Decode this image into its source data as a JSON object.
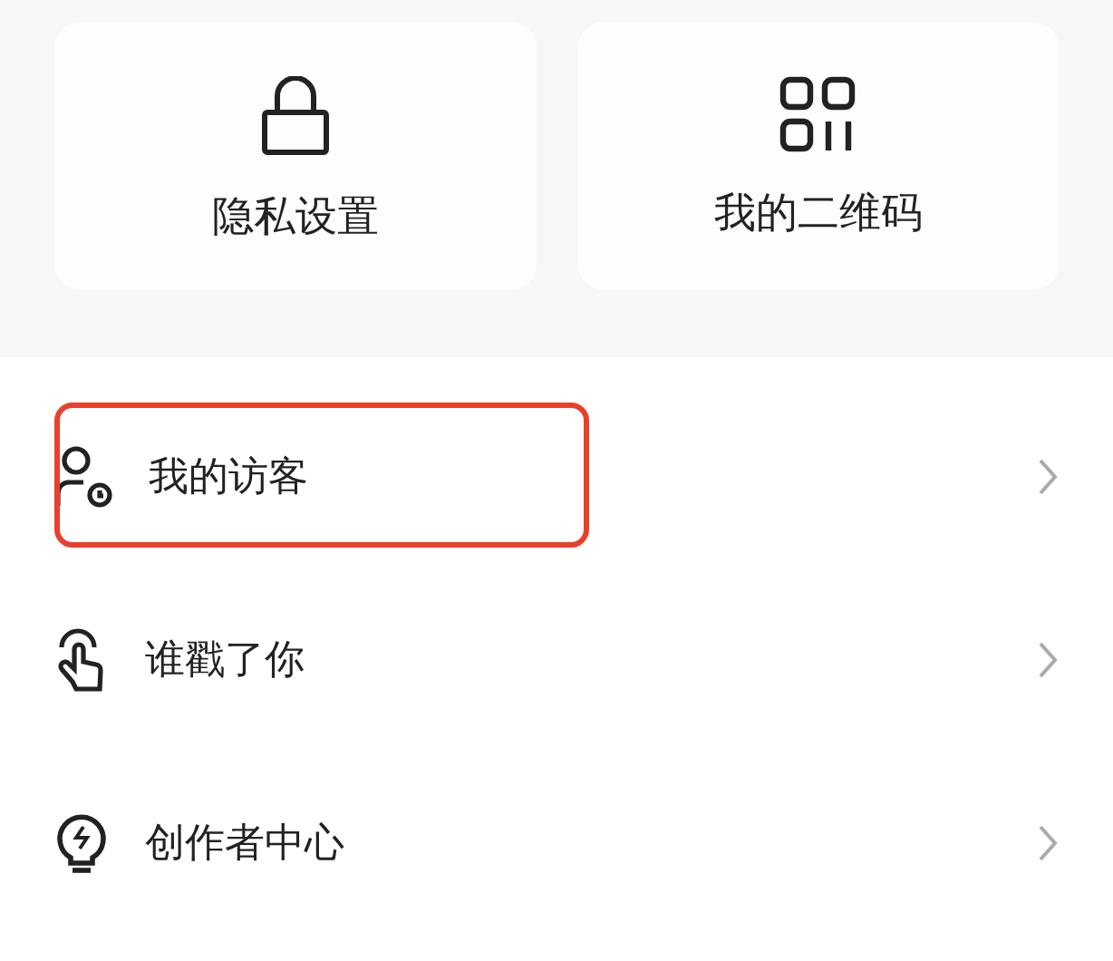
{
  "cards": [
    {
      "kind": "lock",
      "label": "隐私设置"
    },
    {
      "kind": "qr",
      "label": "我的二维码"
    }
  ],
  "menu": [
    {
      "kind": "visitor",
      "label": "我的访客",
      "highlighted": true
    },
    {
      "kind": "poke",
      "label": "谁戳了你",
      "highlighted": false
    },
    {
      "kind": "bulb",
      "label": "创作者中心",
      "highlighted": false
    }
  ]
}
